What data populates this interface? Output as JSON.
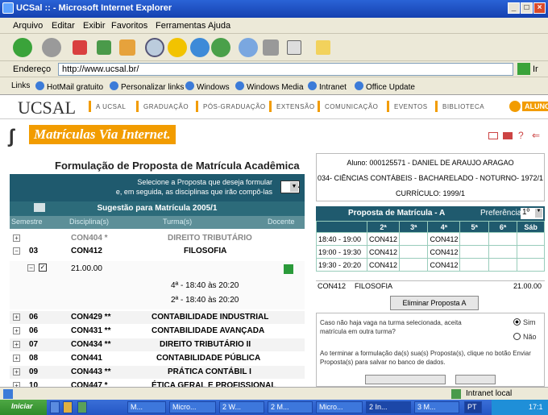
{
  "window": {
    "title": "UCSal :: - Microsoft Internet Explorer",
    "controls": [
      "_",
      "□",
      "×"
    ]
  },
  "menu": [
    "Arquivo",
    "Editar",
    "Exibir",
    "Favoritos",
    "Ferramentas",
    "Ajuda"
  ],
  "address": {
    "label": "Endereço",
    "url": "http://www.ucsal.br/",
    "go": "Ir"
  },
  "links": {
    "label": "Links",
    "items": [
      "HotMail gratuito",
      "Personalizar links",
      "Windows",
      "Windows Media",
      "Intranet",
      "Office Update"
    ]
  },
  "site": {
    "logo": "UCSAL",
    "nav": [
      "A UCSAL",
      "GRADUAÇÃO",
      "PÓS-GRADUAÇÃO",
      "EXTENSÃO",
      "COMUNICAÇÃO",
      "EVENTOS",
      "BIBLIOTECA"
    ],
    "alunos": "ALUNO",
    "banner": "Matrículas Via Internet."
  },
  "page_title": "Formulação de Proposta de Matrícula Acadêmica",
  "instructions": {
    "line1": "Selecione a Proposta que deseja formular",
    "line2": "e, em seguida, as disciplinas que irão compô-las",
    "selected": "A"
  },
  "suggestion_title": "Sugestão para Matrícula 2005/1",
  "columns": {
    "semestre": "Semestre",
    "disciplina": "Disciplina(s)",
    "turma": "Turma(s)",
    "docente": "Docente"
  },
  "rows": [
    {
      "sem": "",
      "code": "CON404 *",
      "name": "DIREITO TRIBUTÁRIO"
    },
    {
      "sem": "03",
      "code": "CON412",
      "name": "FILOSOFIA"
    }
  ],
  "turma": {
    "code": "21.00.00",
    "slot1": "4ª - 18:40 às 20:20",
    "slot2": "2ª - 18:40 às 20:20"
  },
  "rows2": [
    {
      "sem": "06",
      "code": "CON429 **",
      "name": "CONTABILIDADE INDUSTRIAL"
    },
    {
      "sem": "06",
      "code": "CON431 **",
      "name": "CONTABILIDADE AVANÇADA"
    },
    {
      "sem": "07",
      "code": "CON434 **",
      "name": "DIREITO TRIBUTÁRIO II"
    },
    {
      "sem": "08",
      "code": "CON441",
      "name": "CONTABILIDADE PÚBLICA"
    },
    {
      "sem": "09",
      "code": "CON443 **",
      "name": "PRÁTICA CONTÁBIL I"
    },
    {
      "sem": "10",
      "code": "CON447 *",
      "name": "ÉTICA GERAL E PROFISSIONAL"
    }
  ],
  "student": {
    "aluno": "Aluno: 000125571 - DANIEL DE ARAUJO ARAGAO",
    "curso": "034- CIÊNCIAS CONTÁBEIS - BACHARELADO - NOTURNO- 1972/1",
    "curriculo": "CURRÍCULO: 1999/1"
  },
  "proposal": {
    "title": "Proposta de Matrícula - A",
    "pref_label": "Preferência",
    "pref_value": "1º"
  },
  "grid": {
    "days": [
      "2ª",
      "3ª",
      "4ª",
      "5ª",
      "6ª",
      "Sáb"
    ],
    "rows": [
      {
        "time": "18:40 - 19:00",
        "cells": [
          "CON412",
          "",
          "CON412",
          "",
          "",
          ""
        ]
      },
      {
        "time": "19:00 - 19:30",
        "cells": [
          "CON412",
          "",
          "CON412",
          "",
          "",
          ""
        ]
      },
      {
        "time": "19:30 - 20:20",
        "cells": [
          "CON412",
          "",
          "CON412",
          "",
          "",
          ""
        ]
      }
    ]
  },
  "summary": {
    "code": "CON412",
    "name": "FILOSOFIA",
    "turma": "21.00.00"
  },
  "eliminate_button": "Eliminar Proposta A",
  "notice": {
    "text1": "Caso não haja vaga na turma selecionada, aceita matrícula em outra turma?",
    "sim": "Sim",
    "nao": "Não",
    "text2": "Ao terminar a formulação da(s) sua(s) Proposta(s), clique no botão Enviar Proposta(s) para salvar no banco de dados."
  },
  "status": {
    "zone": "Intranet local"
  },
  "taskbar": {
    "start": "Iniciar",
    "items": [
      "M...",
      "Micro...",
      "2 W...",
      "2 M...",
      "Micro...",
      "2 In...",
      "3 M...",
      "PT"
    ],
    "clock": "17:1"
  }
}
